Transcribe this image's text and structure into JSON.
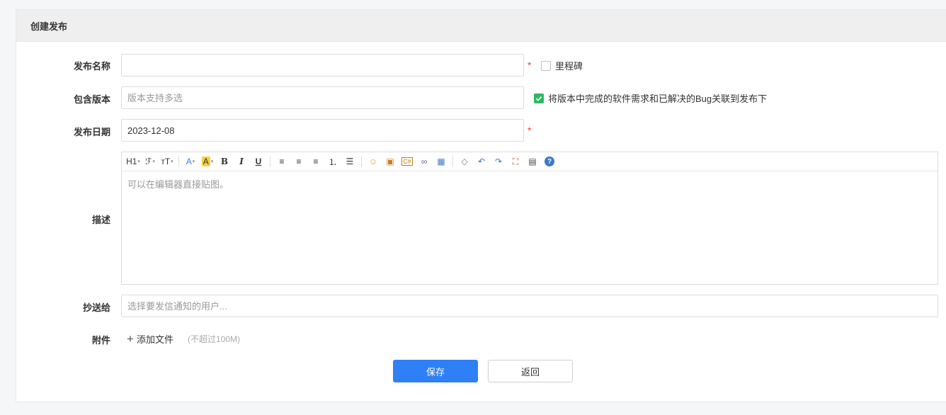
{
  "panel": {
    "title": "创建发布"
  },
  "form": {
    "name": {
      "label": "发布名称",
      "value": "",
      "required": "*"
    },
    "milestone": {
      "label": "里程碑",
      "checked": false
    },
    "builds": {
      "label": "包含版本",
      "placeholder": "版本支持多选"
    },
    "link": {
      "label": "将版本中完成的软件需求和已解决的Bug关联到发布下",
      "checked": true
    },
    "date": {
      "label": "发布日期",
      "value": "2023-12-08",
      "required": "*"
    },
    "desc": {
      "label": "描述",
      "placeholder": "可以在编辑器直接贴图。",
      "toolbar": [
        {
          "name": "heading-icon",
          "glyph": "H1",
          "dropdown": true
        },
        {
          "name": "font-family-icon",
          "glyph": "ℱ",
          "dropdown": true
        },
        {
          "name": "font-size-icon",
          "glyph": "тT",
          "dropdown": true
        },
        {
          "name": "sep"
        },
        {
          "name": "font-color-icon",
          "glyph": "A",
          "dropdown": true,
          "color": "#2f7ff7"
        },
        {
          "name": "highlight-icon",
          "glyph": "A",
          "dropdown": true,
          "bg": "#f7d23c"
        },
        {
          "name": "bold-icon",
          "glyph": "B",
          "bold": true
        },
        {
          "name": "italic-icon",
          "glyph": "I",
          "italic": true
        },
        {
          "name": "underline-icon",
          "glyph": "U",
          "underline": true
        },
        {
          "name": "sep"
        },
        {
          "name": "align-left-icon",
          "glyph": "≡"
        },
        {
          "name": "align-center-icon",
          "glyph": "≡"
        },
        {
          "name": "align-right-icon",
          "glyph": "≡"
        },
        {
          "name": "ordered-list-icon",
          "glyph": "⒈"
        },
        {
          "name": "unordered-list-icon",
          "glyph": "☰"
        },
        {
          "name": "sep"
        },
        {
          "name": "emoji-icon",
          "glyph": "☺",
          "color": "#e8a317"
        },
        {
          "name": "image-icon",
          "glyph": "▣",
          "color": "#c77d1a"
        },
        {
          "name": "code-icon",
          "glyph": "C#",
          "color": "#c77d1a",
          "small": true
        },
        {
          "name": "link-icon",
          "glyph": "∞",
          "color": "#5b6b8a"
        },
        {
          "name": "table-icon",
          "glyph": "▦",
          "color": "#4a7fc1"
        },
        {
          "name": "sep"
        },
        {
          "name": "eraser-icon",
          "glyph": "◇",
          "color": "#777"
        },
        {
          "name": "undo-icon",
          "glyph": "↶",
          "color": "#3a78c9"
        },
        {
          "name": "redo-icon",
          "glyph": "↷",
          "color": "#3a78c9"
        },
        {
          "name": "fullscreen-icon",
          "glyph": "⛶",
          "color": "#c0392b"
        },
        {
          "name": "source-icon",
          "glyph": "▤",
          "color": "#444"
        },
        {
          "name": "help-icon",
          "glyph": "?",
          "color": "#fff",
          "bg": "#3a78c9",
          "round": true
        }
      ]
    },
    "mailto": {
      "label": "抄送给",
      "placeholder": "选择要发信通知的用户..."
    },
    "files": {
      "label": "附件",
      "add_label": "添加文件",
      "hint": "(不超过100M)"
    }
  },
  "actions": {
    "save": "保存",
    "back": "返回"
  }
}
